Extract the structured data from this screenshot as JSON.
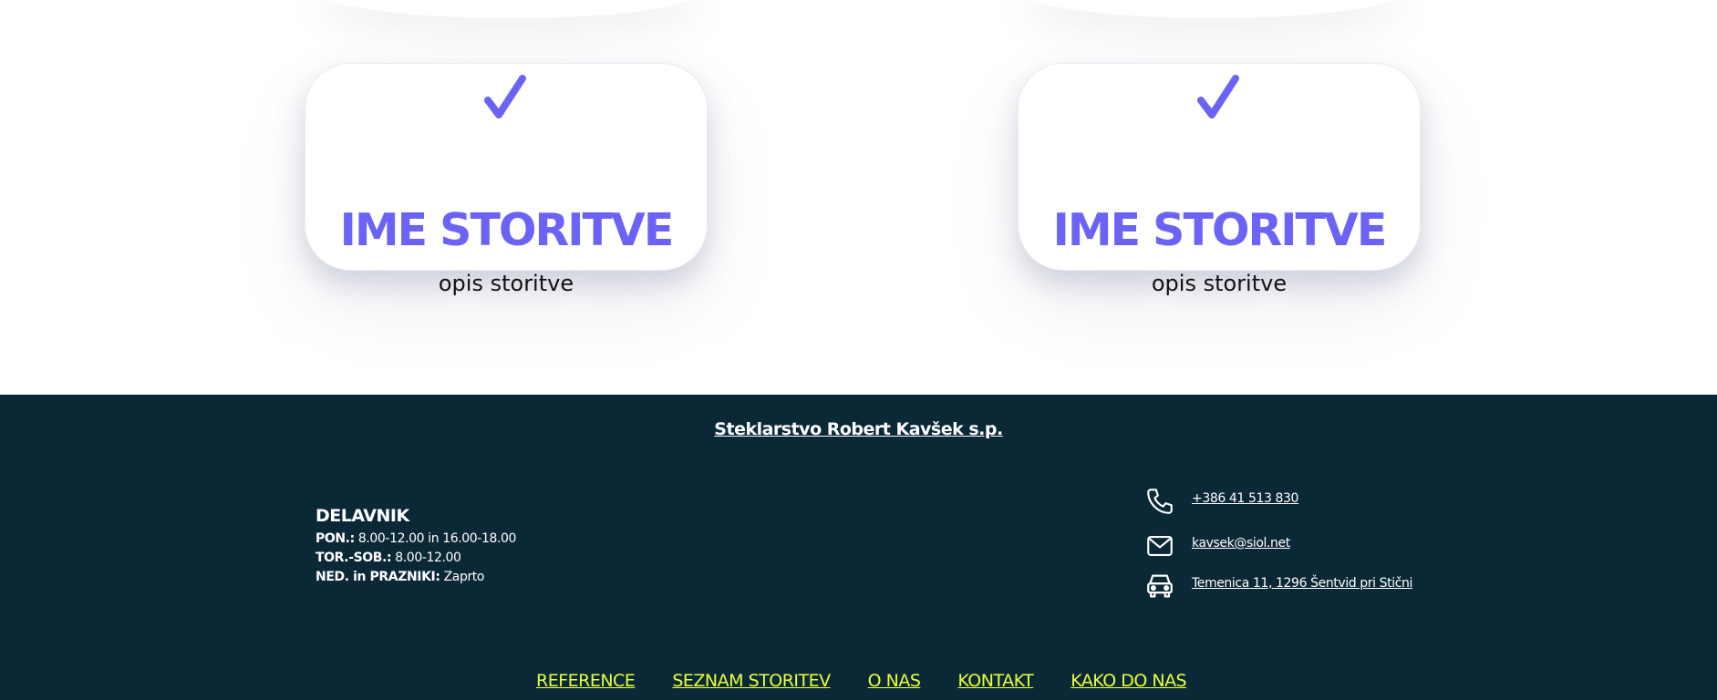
{
  "services": {
    "cards": [
      {
        "icon": "check-icon",
        "title": "IME STORITVE",
        "description": "opis storitve"
      },
      {
        "icon": "check-icon",
        "title": "IME STORITVE",
        "description": "opis storitve"
      }
    ]
  },
  "footer": {
    "company_name": "Steklarstvo Robert Kavšek s.p.",
    "hours": {
      "heading": "DELAVNIK",
      "rows": [
        {
          "label": "PON.:",
          "value": " 8.00-12.00 in 16.00-18.00"
        },
        {
          "label": "TOR.-SOB.:",
          "value": " 8.00-12.00"
        },
        {
          "label": "NED. in PRAZNIKI:",
          "value": " Zaprto"
        }
      ]
    },
    "contact": {
      "phone": {
        "icon": "phone-icon",
        "text": "+386 41 513 830"
      },
      "email": {
        "icon": "mail-icon",
        "text": "kavsek@siol.net"
      },
      "address": {
        "icon": "car-icon",
        "text": "Temenica 11, 1296 Šentvid pri Stični"
      }
    },
    "nav": [
      "REFERENCE",
      "SEZNAM STORITEV",
      "O NAS",
      "KONTAKT",
      "KAKO DO NAS"
    ]
  },
  "colors": {
    "accent": "#6b63f5",
    "footer_bg": "#0b2837",
    "nav_link": "#eaff3a",
    "text_dark": "#111111"
  }
}
